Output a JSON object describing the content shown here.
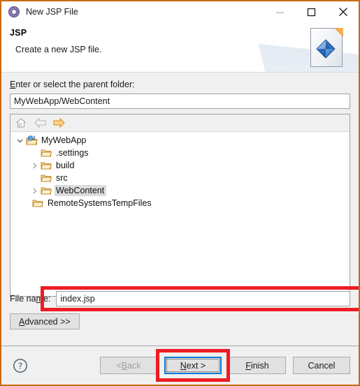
{
  "window": {
    "title": "New JSP File",
    "title_icon": "gear-icon",
    "border_color": "#c96a11",
    "controls": [
      {
        "name": "minimize",
        "glyph": "minimize-icon",
        "disabled": true
      },
      {
        "name": "maximize",
        "glyph": "maximize-icon",
        "disabled": false
      },
      {
        "name": "close",
        "glyph": "close-icon",
        "disabled": false
      }
    ]
  },
  "banner": {
    "title": "JSP",
    "description": "Create a new JSP file.",
    "icon": "jsp-file-page-icon"
  },
  "parent_folder": {
    "label_pre": "E",
    "label_post": "nter or select the parent folder:",
    "value": "MyWebApp/WebContent",
    "placeholder": ""
  },
  "tree_toolbar": [
    {
      "name": "home-icon",
      "enabled": false
    },
    {
      "name": "back-arrow-icon",
      "enabled": false
    },
    {
      "name": "forward-arrow-icon",
      "enabled": true
    }
  ],
  "tree": [
    {
      "label": "MyWebApp",
      "indent": 0,
      "twisty": "expanded",
      "icon": "dynamic-web-project-icon",
      "selected": false
    },
    {
      "label": ".settings",
      "indent": 1,
      "twisty": "none",
      "icon": "folder-icon",
      "selected": false
    },
    {
      "label": "build",
      "indent": 1,
      "twisty": "collapsed",
      "icon": "folder-icon",
      "selected": false
    },
    {
      "label": "src",
      "indent": 1,
      "twisty": "none",
      "icon": "folder-icon",
      "selected": false
    },
    {
      "label": "WebContent",
      "indent": 1,
      "twisty": "collapsed",
      "icon": "folder-icon",
      "selected": true
    },
    {
      "label": "RemoteSystemsTempFiles",
      "indent": 0,
      "twisty": "none",
      "icon": "folder-icon",
      "selected": false
    }
  ],
  "file_name": {
    "label_pre": "File na",
    "label_mn": "m",
    "label_post": "e:",
    "value": "index.jsp",
    "placeholder": ""
  },
  "advanced_button": {
    "label_pre": "A",
    "label_post": "dvanced >>"
  },
  "button_bar": {
    "help": "?",
    "buttons": [
      {
        "name": "back-button",
        "text_pre": "< ",
        "text_mn": "B",
        "text_post": "ack",
        "disabled": true,
        "focused": false
      },
      {
        "name": "next-button",
        "text_pre": "",
        "text_mn": "N",
        "text_post": "ext >",
        "disabled": false,
        "focused": true
      },
      {
        "name": "finish-button",
        "text_pre": "",
        "text_mn": "F",
        "text_post": "inish",
        "disabled": false,
        "focused": false
      },
      {
        "name": "cancel-button",
        "text_pre": "",
        "text_mn": "",
        "text_post": "Cancel",
        "disabled": false,
        "focused": false
      }
    ]
  },
  "annotations": {
    "color": "#ed1c24",
    "boxes": [
      "file-name-field",
      "next-button"
    ]
  }
}
